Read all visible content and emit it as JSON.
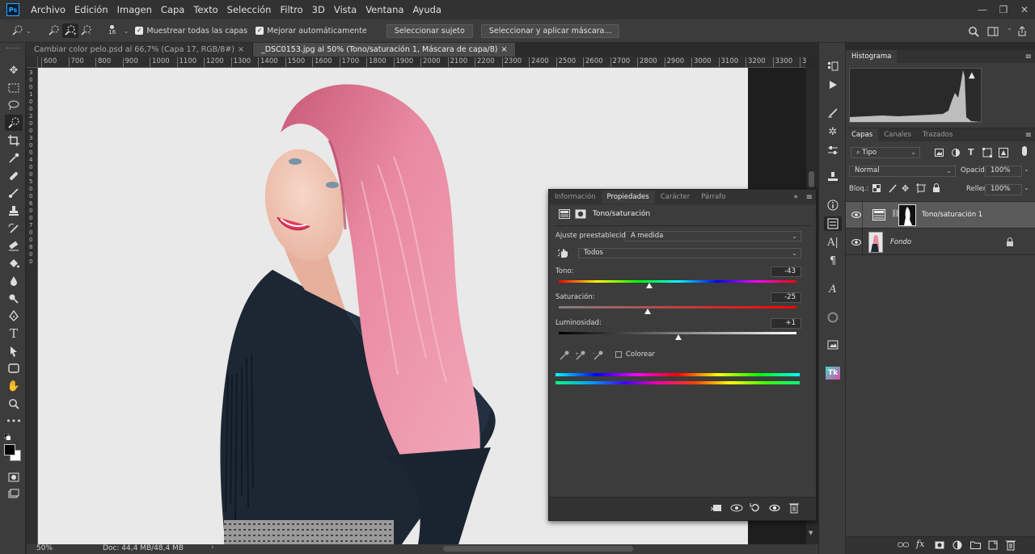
{
  "app": {
    "logo": "Ps"
  },
  "menu": [
    "Archivo",
    "Edición",
    "Imagen",
    "Capa",
    "Texto",
    "Selección",
    "Filtro",
    "3D",
    "Vista",
    "Ventana",
    "Ayuda"
  ],
  "window_controls": [
    "minimize-icon",
    "maximize-icon",
    "close-icon"
  ],
  "options_bar": {
    "brush_size": "16",
    "sample_all_layers": "Muestrear todas las capas",
    "sample_all_checked": true,
    "auto_enhance": "Mejorar automáticamente",
    "auto_enhance_checked": true,
    "select_subject": "Seleccionar sujeto",
    "select_and_mask": "Seleccionar y aplicar máscara..."
  },
  "tabs": [
    {
      "label": "Cambiar color pelo.psd al 66,7% (Capa 17, RGB/8#)",
      "close": "×",
      "active": false
    },
    {
      "label": "_DSC0153.jpg al 50% (Tono/saturación 1, Máscara de capa/8)",
      "close": "×",
      "active": true
    }
  ],
  "ruler_labels": [
    "600",
    "700",
    "800",
    "900",
    "1000",
    "1100",
    "1200",
    "1300",
    "1400",
    "1500",
    "1600",
    "1700",
    "1800",
    "1900",
    "2000",
    "2100",
    "2200",
    "2300",
    "2400",
    "2500",
    "2600",
    "2700",
    "2800",
    "2900",
    "3000",
    "3100",
    "3200",
    "3300",
    "34"
  ],
  "vruler_labels": [
    "3",
    "0",
    "0",
    "1",
    "0",
    "0",
    "2",
    "0",
    "0",
    "3",
    "0",
    "0",
    "4",
    "0",
    "0",
    "5",
    "0",
    "0",
    "6",
    "0",
    "0",
    "7",
    "0",
    "0",
    "8",
    "0",
    "0"
  ],
  "status": {
    "zoom": "50%",
    "doc": "Doc: 44,4 MB/48,4 MB",
    "arrow": "›"
  },
  "histogram": {
    "title": "Histograma",
    "warning": "▲"
  },
  "layers_panel": {
    "tabs": [
      "Capas",
      "Canales",
      "Trazados"
    ],
    "filter": "Tipo",
    "blend_mode": "Normal",
    "opacity_label": "Opacidad:",
    "opacity": "100%",
    "lock_label": "Bloq.:",
    "fill_label": "Relleno:",
    "fill": "100%",
    "layers": [
      {
        "name": "Tono/saturación 1",
        "visible": true,
        "selected": true
      },
      {
        "name": "Fondo",
        "visible": true,
        "selected": false,
        "locked": true
      }
    ]
  },
  "properties_panel": {
    "tabs": [
      "Información",
      "Propiedades",
      "Carácter",
      "Párrafo"
    ],
    "title": "Tono/saturación",
    "preset_label": "Ajuste preestablecido:",
    "preset": "A medida",
    "channel": "Todos",
    "hue_label": "Tono:",
    "hue": "-43",
    "hue_value": -43,
    "sat_label": "Saturación:",
    "sat": "-25",
    "sat_value": -25,
    "light_label": "Luminosidad:",
    "light": "+1",
    "light_value": 1,
    "colorize_label": "Colorear",
    "colorize_checked": false
  },
  "colors": {
    "accent": "#31a8ff",
    "hair": "#e88ba0",
    "shirt": "#1d2733",
    "background": "#e8e8e8"
  }
}
